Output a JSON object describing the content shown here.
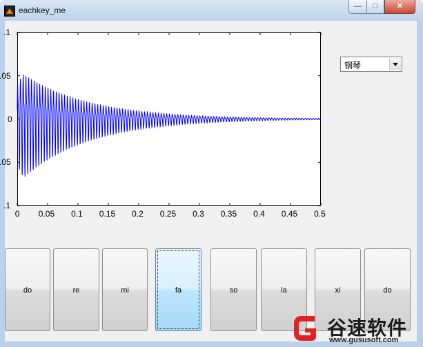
{
  "window": {
    "title": "eachkey_me",
    "controls": {
      "minimize": "—",
      "maximize": "□",
      "close": "✕"
    }
  },
  "instrument_select": {
    "selected": "钢琴"
  },
  "plot": {
    "line_color": "#0000ff",
    "x_ticks": [
      "0",
      "0.05",
      "0.1",
      "0.15",
      "0.2",
      "0.25",
      "0.3",
      "0.35",
      "0.4",
      "0.45",
      "0.5"
    ],
    "y_ticks": [
      ".1",
      ".05",
      "0",
      ".05",
      ".1"
    ],
    "chart_data": {
      "type": "line",
      "title": "",
      "xlabel": "",
      "ylabel": "",
      "xlim": [
        0,
        0.5
      ],
      "ylim": [
        -0.1,
        0.1
      ],
      "grid": false,
      "description_values": {
        "peak_amplitude": 0.065,
        "decay": "exponential"
      }
    }
  },
  "keys": [
    {
      "label": "do"
    },
    {
      "label": "re"
    },
    {
      "label": "mi"
    },
    {
      "label": "fa"
    },
    {
      "label": "so"
    },
    {
      "label": "la"
    },
    {
      "label": "xi"
    },
    {
      "label": "do"
    }
  ],
  "watermark": {
    "name": "谷速软件",
    "url": "www.gususoft.com",
    "color": "#e02424"
  }
}
